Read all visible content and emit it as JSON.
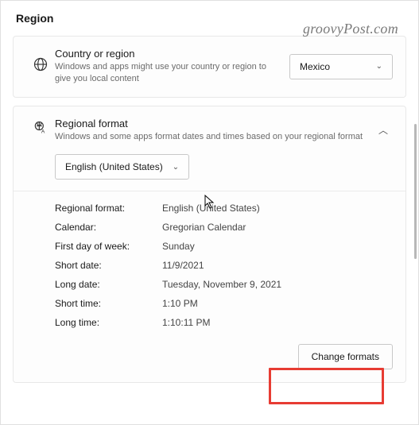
{
  "page": {
    "title": "Region"
  },
  "watermark": "groovyPost.com",
  "country_card": {
    "title": "Country or region",
    "desc": "Windows and apps might use your country or region to give you local content",
    "selected": "Mexico"
  },
  "regional_card": {
    "title": "Regional format",
    "desc": "Windows and some apps format dates and times based on your regional format",
    "selected": "English (United States)"
  },
  "details": {
    "regional_format_label": "Regional format:",
    "regional_format_value": "English (United States)",
    "calendar_label": "Calendar:",
    "calendar_value": "Gregorian Calendar",
    "first_day_label": "First day of week:",
    "first_day_value": "Sunday",
    "short_date_label": "Short date:",
    "short_date_value": "11/9/2021",
    "long_date_label": "Long date:",
    "long_date_value": "Tuesday, November 9, 2021",
    "short_time_label": "Short time:",
    "short_time_value": "1:10 PM",
    "long_time_label": "Long time:",
    "long_time_value": "1:10:11 PM"
  },
  "buttons": {
    "change_formats": "Change formats"
  }
}
